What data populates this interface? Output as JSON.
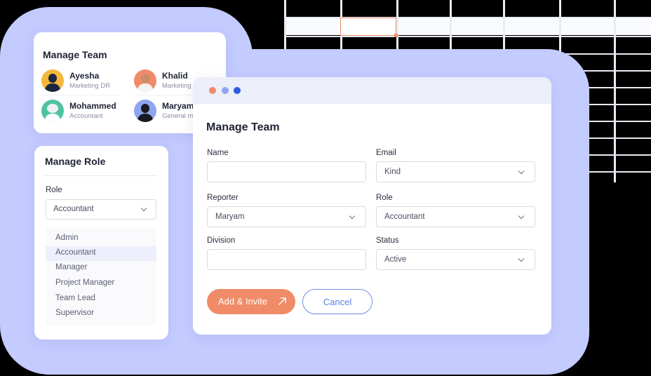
{
  "team_card": {
    "title": "Manage Team",
    "members": [
      {
        "name": "Ayesha",
        "role": "Marketing DR"
      },
      {
        "name": "Khalid",
        "role": "Marketing"
      },
      {
        "name": "Mohammed",
        "role": "Accountant"
      },
      {
        "name": "Maryam",
        "role": "General m"
      }
    ]
  },
  "role_card": {
    "title": "Manage Role",
    "role_label": "Role",
    "selected_role": "Accountant",
    "options": [
      "Admin",
      "Accountant",
      "Manager",
      "Project Manager",
      "Team Lead",
      "Supervisor"
    ]
  },
  "form": {
    "title": "Manage Team",
    "name_label": "Name",
    "name_value": "",
    "email_label": "Email",
    "email_value": "Kind",
    "reporter_label": "Reporter",
    "reporter_value": "Maryam",
    "role_label": "Role",
    "role_value": "Accountant",
    "division_label": "Division",
    "division_value": "",
    "status_label": "Status",
    "status_value": "Active",
    "add_invite_label": "Add & Invite",
    "cancel_label": "Cancel"
  },
  "colors": {
    "accent": "#f08b67",
    "secondary": "#5d7ee0",
    "backdrop": "#c4cbff",
    "window_dots": [
      "#f28b6b",
      "#8ea5ef",
      "#2d5be3"
    ]
  },
  "icons": [
    "chevron-down-icon",
    "arrow-up-right-icon",
    "avatar"
  ]
}
